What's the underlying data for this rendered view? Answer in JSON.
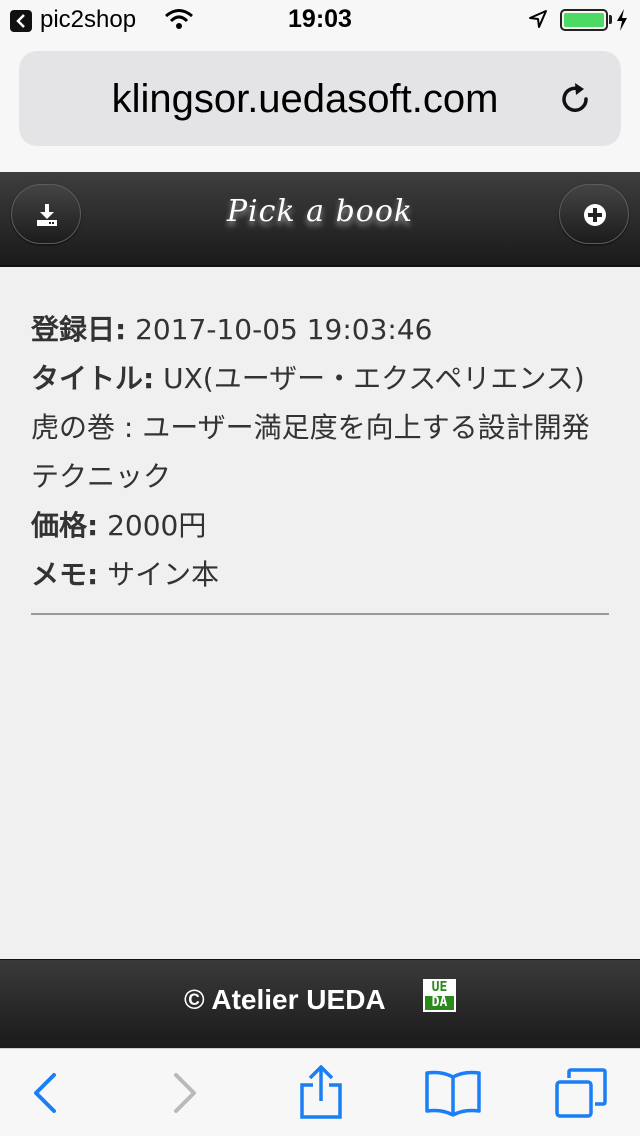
{
  "status_bar": {
    "back_app": "pic2shop",
    "time": "19:03"
  },
  "url_bar": {
    "domain": "klingsor.uedasoft.com"
  },
  "header": {
    "title": "Pick a book"
  },
  "record": {
    "registered_label": "登録日:",
    "registered_value": "2017-10-05 19:03:46",
    "title_label": "タイトル:",
    "title_value": "UX(ユーザー・エクスペリエンス)虎の巻 : ユーザー満足度を向上する設計開発テクニック",
    "price_label": "価格:",
    "price_value": "2000円",
    "memo_label": "メモ:",
    "memo_value": "サイン本"
  },
  "footer": {
    "copyright": "© Atelier UEDA",
    "logo_top": "UE",
    "logo_bottom": "DA"
  },
  "colors": {
    "header_bg": "#1f1f1f",
    "toolbar_accent": "#1a7ff5",
    "battery": "#4cd964",
    "logo_green": "#2b8a1b"
  }
}
